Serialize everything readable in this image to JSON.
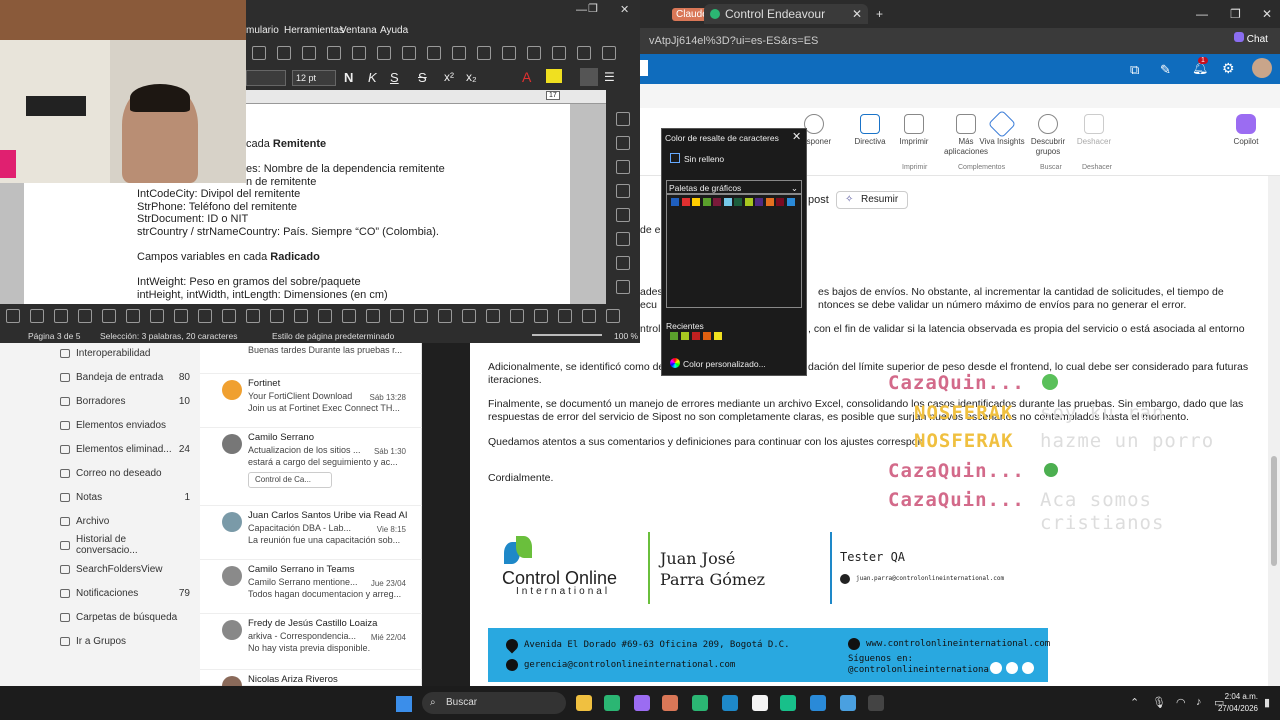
{
  "browser": {
    "tab1": "Claude",
    "tab2": "Control Endeavour",
    "url": "vAtpJj614el%3D?ui=es-ES&rs=ES",
    "chat_label": "Chat",
    "badge": "1"
  },
  "ribbon": {
    "buttons": [
      "Posponer",
      "Directiva",
      "Imprimir",
      "Más aplicaciones",
      "Viva Insights",
      "Descubrir grupos",
      "Deshacer",
      "Copilot"
    ],
    "groups": [
      "Imprimir",
      "Complementos",
      "Buscar",
      "Deshacer"
    ],
    "resumir": "Resumir",
    "sipost": "post"
  },
  "writer": {
    "menu": [
      "mulario",
      "Herramientas",
      "Ventana",
      "Ayuda"
    ],
    "font_size": "12 pt",
    "ruler_mark": "17",
    "lines": [
      "cada Remitente",
      "es: Nombre de la dependencia remitente",
      "n de remitente",
      "IntCodeCity: Divipol del remitente",
      "StrPhone: Teléfono del remitente",
      "StrDocument: ID o NIT",
      "strCountry / strNameCountry: País. Siempre “CO” (Colombia).",
      "Campos variables en cada Radicado",
      "IntWeight: Peso en gramos del sobre/paquete",
      "intHeight, intWidth, intLength: Dimensiones (en cm)"
    ],
    "status": {
      "page": "Página 3 de 5",
      "selection": "Selección: 3 palabras, 20 caracteres",
      "style": "Estilo de página predeterminado",
      "zoom": "100 %"
    }
  },
  "dialog": {
    "title": "Color de resalte de caracteres",
    "none": "Sin relleno",
    "palette": "Paletas de gráficos",
    "recent": "Recientes",
    "custom": "Color personalizado...",
    "colors": [
      "#1f5fbf",
      "#e03030",
      "#ffcc00",
      "#5aa02c",
      "#7a1a3a",
      "#76c8e8",
      "#1c5e3c",
      "#a8c820",
      "#4e2a84",
      "#e57020",
      "#7a0a20",
      "#2a8ad8"
    ],
    "recent_colors": [
      "#5aa02c",
      "#a8c820",
      "#c02020",
      "#e06010",
      "#f0e020"
    ]
  },
  "email": {
    "p1a": "ades",
    "p1b": "es bajos de envíos. No obstante, al incrementar la cantidad de solicitudes, el tiempo de",
    "p1c": "ecu",
    "p1d": "ntonces se debe validar un número máximo de envíos para no generar el error.",
    "p2a": "ntrol",
    "p2b": ", con el fin de validar si la latencia observada es propia del servicio o está asociada al entorno",
    "p3": "Adicionalmente, se identificó como de",
    "p3b": "dación del límite superior de peso desde el frontend, lo cual debe ser considerado para futuras",
    "p3c": "iteraciones.",
    "p4": "Finalmente, se documentó un manejo de errores mediante un archivo Excel, consolidando los casos identificados durante las pruebas. Sin embargo, dado que las",
    "p4b": "respuestas de error del servicio de Sipost no son completamente claras, es posible que surjan nuevos escenarios no contemplados hasta el momento.",
    "p5": "Quedamos atentos a sus comentarios y definiciones para continuar con los ajustes correspon",
    "p6": "Cordialmente.",
    "partial": "de en"
  },
  "chat_overlay": {
    "n1": "CazaQuin...",
    "n2": "NOSFERAK",
    "m2": "soy ku ran",
    "n3": "NOSFERAK",
    "m3": "hazme un porro",
    "n4": "CazaQuin...",
    "n5": "CazaQuin...",
    "m5": "Aca somos cristianos"
  },
  "signature": {
    "company1": "Control Online",
    "company2": "International",
    "name1": "Juan José",
    "name2": "Parra Gómez",
    "role": "Tester QA",
    "email": "juan.parra@controlonlineinternational.com",
    "address": "Avenida El Dorado #69-63 Oficina 209, Bogotá D.C.",
    "web": "www.controlonlineinternational.com",
    "mail2": "gerencia@controlonlineinternational.com",
    "follow": "Síguenos en:",
    "handle": "@controlonlineinternationa"
  },
  "folders": [
    {
      "name": "Interoperabilidad",
      "count": ""
    },
    {
      "name": "Bandeja de entrada",
      "count": "80"
    },
    {
      "name": "Borradores",
      "count": "10"
    },
    {
      "name": "Elementos enviados",
      "count": ""
    },
    {
      "name": "Elementos eliminad...",
      "count": "24"
    },
    {
      "name": "Correo no deseado",
      "count": ""
    },
    {
      "name": "Notas",
      "count": "1"
    },
    {
      "name": "Archivo",
      "count": ""
    },
    {
      "name": "Historial de conversacio...",
      "count": ""
    },
    {
      "name": "SearchFoldersView",
      "count": ""
    },
    {
      "name": "Notificaciones",
      "count": "79"
    },
    {
      "name": "Carpetas de búsqueda",
      "count": ""
    },
    {
      "name": "Ir a Grupos",
      "count": ""
    }
  ],
  "messages": [
    {
      "sender": "",
      "subject": "",
      "preview": "Buenas tardes Durante las pruebas r...",
      "date": ""
    },
    {
      "sender": "Fortinet",
      "subject": "Your FortiClient Download",
      "preview": "Join us at Fortinet Exec Connect TH...",
      "date": "Sáb 13:28"
    },
    {
      "sender": "Camilo Serrano",
      "subject": "Actualizacion de los sitios ...",
      "preview": "estará a cargo del seguimiento y ac...",
      "date": "Sáb 1:30",
      "attach": "Control de Ca..."
    },
    {
      "sender": "Juan Carlos Santos Uribe via Read AI",
      "subject": "Capacitación DBA - Lab...",
      "preview": "La reunión fue una capacitación sob...",
      "date": "Vie 8:15"
    },
    {
      "sender": "Camilo Serrano in Teams",
      "subject": "Camilo Serrano mentione...",
      "preview": "Todos hagan documentacion y arreg...",
      "date": "Jue 23/04"
    },
    {
      "sender": "Fredy de Jesús Castillo Loaiza",
      "subject": "arkiva - Correspondencia...",
      "preview": "No hay vista previa disponible.",
      "date": "Mié 22/04"
    },
    {
      "sender": "Nicolas Ariza Riveros",
      "subject": "",
      "preview": "",
      "date": ""
    }
  ],
  "taskbar": {
    "search": "Buscar",
    "time": "2:04 a.m.",
    "date": "27/04/2026"
  }
}
